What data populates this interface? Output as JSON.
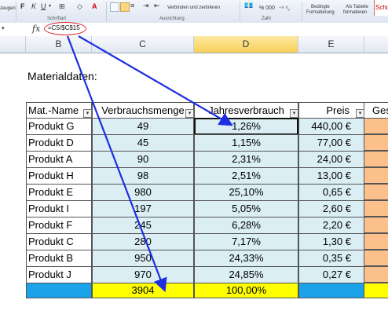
{
  "ribbon": {
    "left_label": "zeugen",
    "font_group_label": "Schriftart",
    "align_group_label": "Ausrichtung",
    "number_group_label": "Zahl",
    "merge_label": "Verbinden und zentrieren",
    "number_format_icons": "% 000",
    "decimals_icons": "⁺⁰ ⁰₀",
    "cond_format_line1": "Bedingte",
    "cond_format_line2": "Formatierung",
    "table_format_line1": "Als Tabelle",
    "table_format_line2": "formatieren",
    "cell_styles_label": "Schi"
  },
  "formula_bar": {
    "fx": "fx",
    "formula": "=C5/$C$15"
  },
  "columns": [
    "B",
    "C",
    "D",
    "E"
  ],
  "sheet": {
    "section_title": "Materialdaten:",
    "headers": {
      "name": "Mat.-Name",
      "qty": "Verbrauchsmenge",
      "pct": "Jahresverbrauch",
      "price": "Preis",
      "extra": "Ges"
    },
    "rows": [
      {
        "name": "Produkt G",
        "qty": "49",
        "pct": "1,26%",
        "price": "440,00 €"
      },
      {
        "name": "Produkt D",
        "qty": "45",
        "pct": "1,15%",
        "price": "77,00 €"
      },
      {
        "name": "Produkt A",
        "qty": "90",
        "pct": "2,31%",
        "price": "24,00 €"
      },
      {
        "name": "Produkt H",
        "qty": "98",
        "pct": "2,51%",
        "price": "13,00 €"
      },
      {
        "name": "Produkt E",
        "qty": "980",
        "pct": "25,10%",
        "price": "0,65 €"
      },
      {
        "name": "Produkt I",
        "qty": "197",
        "pct": "5,05%",
        "price": "2,60 €"
      },
      {
        "name": "Produkt F",
        "qty": "245",
        "pct": "6,28%",
        "price": "2,20 €"
      },
      {
        "name": "Produkt C",
        "qty": "280",
        "pct": "7,17%",
        "price": "1,30 €"
      },
      {
        "name": "Produkt B",
        "qty": "950",
        "pct": "24,33%",
        "price": "0,35 €"
      },
      {
        "name": "Produkt J",
        "qty": "970",
        "pct": "24,85%",
        "price": "0,27 €"
      }
    ],
    "totals": {
      "qty": "3904",
      "pct": "100,00%"
    }
  },
  "colors": {
    "annotation": "#1d2fe0",
    "highlight_yellow": "#ffff00",
    "total_blue": "#1aa3e8",
    "data_fill": "#dbeef4",
    "extra_col": "#fbc08c"
  }
}
